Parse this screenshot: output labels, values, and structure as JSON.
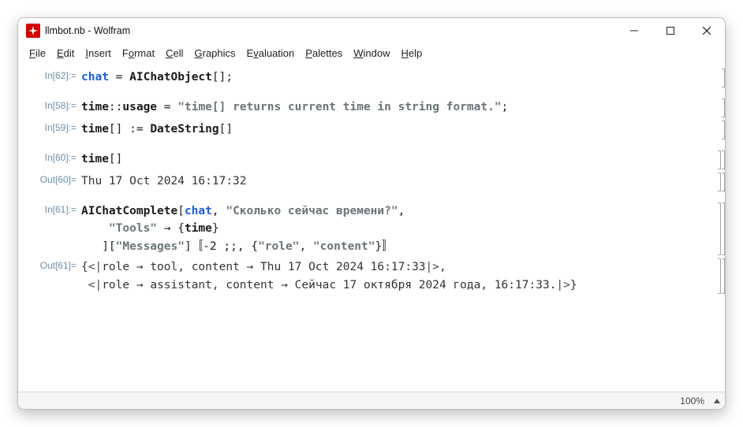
{
  "window": {
    "title": "llmbot.nb - Wolfram"
  },
  "menu": {
    "file": {
      "label": "File",
      "u": "F"
    },
    "edit": {
      "label": "Edit",
      "u": "E"
    },
    "insert": {
      "label": "Insert",
      "u": "I"
    },
    "format": {
      "label": "Format",
      "u": "o"
    },
    "cell": {
      "label": "Cell",
      "u": "C"
    },
    "graphics": {
      "label": "Graphics",
      "u": "G"
    },
    "evaluation": {
      "label": "Evaluation",
      "u": "v"
    },
    "palettes": {
      "label": "Palettes",
      "u": "P"
    },
    "window": {
      "label": "Window",
      "u": "W"
    },
    "help": {
      "label": "Help",
      "u": "H"
    }
  },
  "cells": [
    {
      "kind": "in",
      "label": "In[62]:=",
      "code_html": "<span class='undef'>chat</span> <span class='op'>=</span> <span class='sym'>AIChatObject</span>[<span class='op'>]</span>;"
    },
    {
      "kind": "in",
      "label": "In[58]:=",
      "code_html": "<span class='blk'>time</span><span class='op'>::</span><span class='kwd'>usage</span> <span class='op'>=</span> <span class='str'>\"time[] returns current time in string format.\"</span>;"
    },
    {
      "kind": "in",
      "label": "In[59]:=",
      "code_html": "<span class='blk'>time</span>[<span class='op'>]</span> <span class='op'>:=</span> <span class='sym'>DateString</span>[<span class='op'>]</span>"
    },
    {
      "kind": "in",
      "label": "In[60]:=",
      "code_html": "<span class='blk'>time</span>[<span class='op'>]</span>"
    },
    {
      "kind": "out",
      "label": "Out[60]=",
      "code_html": "<span class='out-plain'>Thu 17 Oct 2024 16:17:32</span>"
    },
    {
      "kind": "in",
      "label": "In[61]:=",
      "code_html": "<span class='sym'>AIChatComplete</span>[<span class='undef'>chat</span>, <span class='str'>\"Сколько сейчас времени?\"</span>,\n    <span class='str'>\"Tools\"</span> <span class='rarrow'>→</span> {<span class='blk'>time</span>}\n   ][<span class='str'>\"Messages\"</span>]〚<span class='op'>-2 ;;</span>, {<span class='str'>\"role\"</span>, <span class='str'>\"content\"</span>}〛"
    },
    {
      "kind": "out",
      "label": "Out[61]=",
      "code_html": "<span class='out-plain'>{<span class='assoc'>&lt;|</span>role <span class='rarrow'>→</span> tool, content <span class='rarrow'>→</span> Thu 17 Oct 2024 16:17:33<span class='assoc'>|&gt;</span>,\n <span class='assoc'>&lt;|</span>role <span class='rarrow'>→</span> assistant, content <span class='rarrow'>→</span> Сейчас 17 октября 2024 года, 16:17:33.<span class='assoc'>|&gt;</span>}</span>"
    }
  ],
  "status": {
    "zoom": "100%"
  }
}
